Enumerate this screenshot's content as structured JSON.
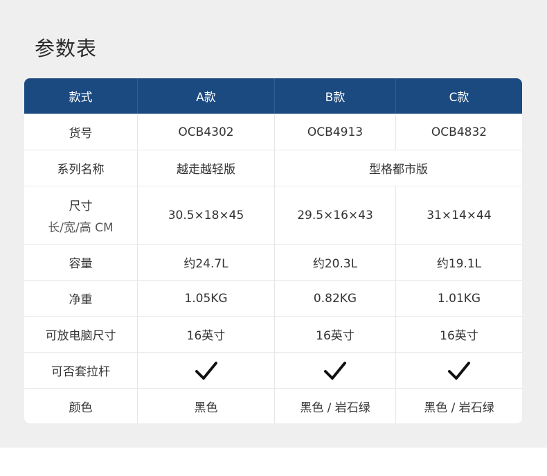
{
  "title": "参数表",
  "header": {
    "col0": "款式",
    "col1": "A款",
    "col2": "B款",
    "col3": "C款"
  },
  "rows": {
    "item_no": {
      "label": "货号",
      "a": "OCB4302",
      "b": "OCB4913",
      "c": "OCB4832"
    },
    "series": {
      "label": "系列名称",
      "a": "越走越轻版",
      "bc": "型格都市版"
    },
    "size": {
      "label": "尺寸",
      "sublabel": "长/宽/高  CM",
      "a": "30.5×18×45",
      "b": "29.5×16×43",
      "c": "31×14×44"
    },
    "capacity": {
      "label": "容量",
      "a": "约24.7L",
      "b": "约20.3L",
      "c": "约19.1L"
    },
    "weight": {
      "label": "净重",
      "a": "1.05KG",
      "b": "0.82KG",
      "c": "1.01KG"
    },
    "laptop": {
      "label": "可放电脑尺寸",
      "a": "16英寸",
      "b": "16英寸",
      "c": "16英寸"
    },
    "trolley": {
      "label": "可否套拉杆",
      "a_icon": "checkmark-icon",
      "b_icon": "checkmark-icon",
      "c_icon": "checkmark-icon"
    },
    "color": {
      "label": "颜色",
      "a": "黑色",
      "b": "黑色 / 岩石绿",
      "c": "黑色 / 岩石绿"
    }
  },
  "colors": {
    "header_bg": "#1b4a80",
    "page_bg": "#efeff0",
    "table_bg": "#ffffff"
  }
}
